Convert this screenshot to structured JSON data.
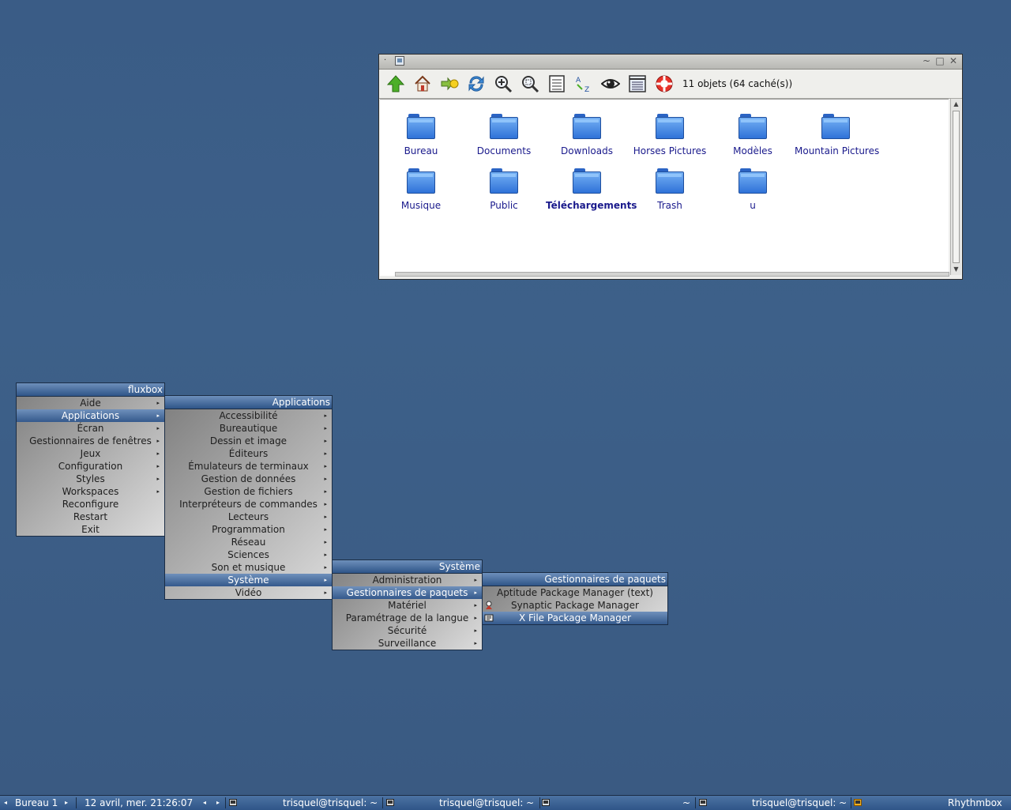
{
  "file_manager": {
    "title_left_glyph": "·",
    "window_buttons": {
      "minimize": "~",
      "maximize": "□",
      "close": "✕"
    },
    "status": "11 objets (64 caché(s))",
    "toolbar_icons": [
      "up-arrow-icon",
      "home-icon",
      "go-to-icon",
      "refresh-icon",
      "zoom-in-icon",
      "zoom-fit-icon",
      "list-view-icon",
      "sort-az-icon",
      "show-hidden-icon",
      "detail-view-icon",
      "help-icon"
    ],
    "items": [
      {
        "label": "Bureau"
      },
      {
        "label": "Documents"
      },
      {
        "label": "Downloads"
      },
      {
        "label": "Horses Pictures"
      },
      {
        "label": "Modèles"
      },
      {
        "label": "Mountain Pictures"
      },
      {
        "label": "Musique"
      },
      {
        "label": "Public"
      },
      {
        "label": "Téléchargements"
      },
      {
        "label": "Trash"
      },
      {
        "label": "u"
      }
    ]
  },
  "menus": {
    "root": {
      "title": "fluxbox",
      "items": [
        "Aide",
        "Applications",
        "Écran",
        "Gestionnaires de fenêtres",
        "Jeux",
        "Configuration",
        "Styles",
        "Workspaces",
        "Reconfigure",
        "Restart",
        "Exit"
      ]
    },
    "applications": {
      "title": "Applications",
      "items": [
        "Accessibilité",
        "Bureautique",
        "Dessin et image",
        "Éditeurs",
        "Émulateurs de terminaux",
        "Gestion de données",
        "Gestion de fichiers",
        "Interpréteurs de commandes",
        "Lecteurs",
        "Programmation",
        "Réseau",
        "Sciences",
        "Son et musique",
        "Système",
        "Vidéo"
      ]
    },
    "systeme": {
      "title": "Système",
      "items": [
        "Administration",
        "Gestionnaires de paquets",
        "Matériel",
        "Paramétrage de la langue",
        "Sécurité",
        "Surveillance"
      ]
    },
    "paquets": {
      "title": "Gestionnaires de paquets",
      "items": [
        "Aptitude Package Manager (text)",
        "Synaptic Package Manager",
        "X File Package Manager"
      ]
    },
    "submenu_arrow": "▸"
  },
  "taskbar": {
    "workspace": "Bureau 1",
    "prev_arrow": "◂",
    "next_arrow": "▸",
    "clock": "12 avril, mer. 21:26:07",
    "tasks": [
      {
        "label": "trisquel@trisquel: ~"
      },
      {
        "label": "trisquel@trisquel: ~"
      },
      {
        "label": "~"
      },
      {
        "label": "trisquel@trisquel: ~"
      },
      {
        "label": "Rhythmbox"
      }
    ]
  }
}
